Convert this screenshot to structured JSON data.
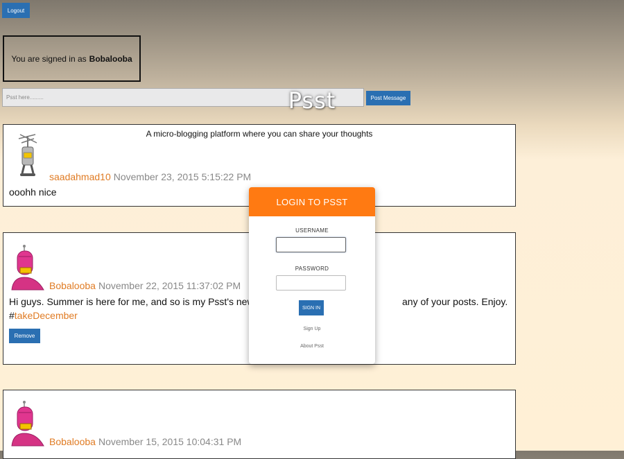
{
  "header": {
    "logout_label": "Logout",
    "signed_in_prefix": "You are signed in as",
    "signed_in_user": "Bobalooba",
    "post_placeholder": "Psst here.........",
    "post_button": "Post Message",
    "site_title": "Psst",
    "tagline": "A micro-blogging platform where you can share your thoughts"
  },
  "posts": [
    {
      "username": "saadahmad10",
      "timestamp": "November 23, 2015 5:15:22 PM",
      "text": "ooohh nice",
      "avatar": "antenna-robot-avatar"
    },
    {
      "username": "Bobalooba",
      "timestamp": "November 22, 2015 11:37:02 PM",
      "text_start": "Hi guys. Summer is here for me, and so is my Psst's new",
      "text_end": "any of your posts. Enjoy.",
      "hash_prefix": "#",
      "hashtag": "takeDecember",
      "remove_label": "Remove",
      "avatar": "pink-robot-avatar"
    },
    {
      "username": "Bobalooba",
      "timestamp": "November 15, 2015 10:04:31 PM",
      "avatar": "pink-robot-avatar"
    }
  ],
  "login": {
    "title": "LOGIN TO PSST",
    "username_label": "USERNAME",
    "username_value": "",
    "password_label": "PASSWORD",
    "password_value": "",
    "signin_label": "SIGN IN",
    "signup_link": "Sign Up",
    "about_link": "About Psst"
  },
  "colors": {
    "accent_orange": "#ff7a12",
    "username_orange": "#e07b23",
    "button_blue": "#2a6fb2"
  }
}
